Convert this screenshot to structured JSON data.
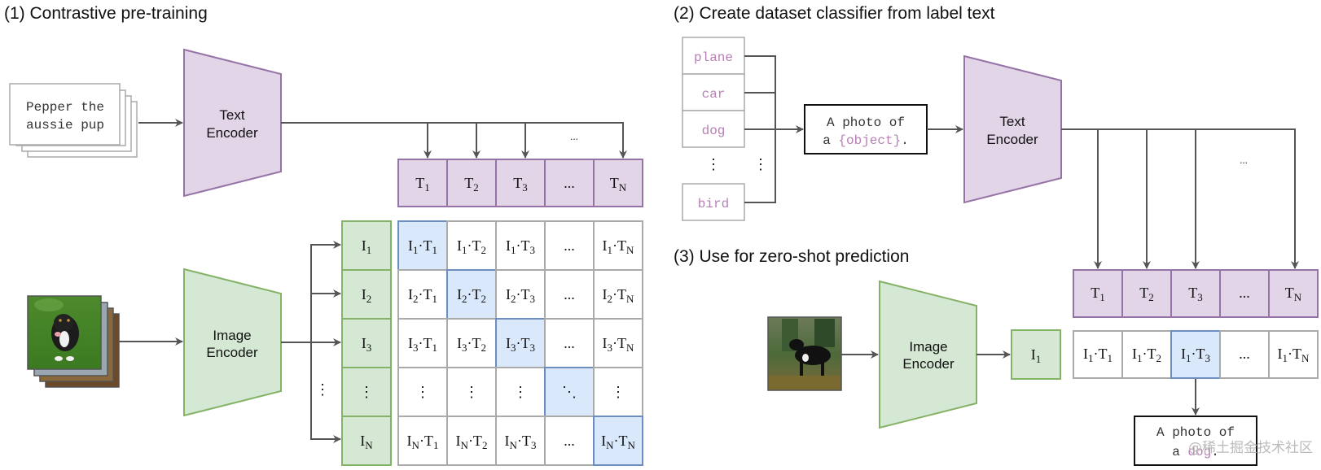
{
  "section1": {
    "title": "(1) Contrastive pre-training",
    "text_input": [
      "Pepper the",
      "aussie pup"
    ],
    "text_encoder": [
      "Text",
      "Encoder"
    ],
    "image_encoder": [
      "Image",
      "Encoder"
    ],
    "text_embeddings": [
      {
        "base": "T",
        "sub": "1"
      },
      {
        "base": "T",
        "sub": "2"
      },
      {
        "base": "T",
        "sub": "3"
      },
      {
        "base": "...",
        "sub": ""
      },
      {
        "base": "T",
        "sub": "N"
      }
    ],
    "image_embeddings": [
      {
        "base": "I",
        "sub": "1"
      },
      {
        "base": "I",
        "sub": "2"
      },
      {
        "base": "I",
        "sub": "3"
      },
      {
        "base": "⋮",
        "sub": ""
      },
      {
        "base": "I",
        "sub": "N"
      }
    ],
    "arrow_ellipsis": "...",
    "vertical_ellipsis": "⋮",
    "matrix_rows": [
      "1",
      "2",
      "3",
      "",
      "N"
    ],
    "matrix_cols": [
      "1",
      "2",
      "3",
      "",
      "N"
    ],
    "ellipsis_h": "...",
    "ellipsis_v": "⋮",
    "ellipsis_diag": "⋱"
  },
  "section2": {
    "title": "(2) Create dataset classifier from label text",
    "labels": [
      "plane",
      "car",
      "dog",
      "bird"
    ],
    "label_ellipsis": "⋮",
    "template_line1": "A photo of",
    "template_line2_prefix": "a ",
    "template_placeholder": "{object}",
    "template_line2_suffix": ".",
    "text_encoder": [
      "Text",
      "Encoder"
    ],
    "arrow_ellipsis": "..."
  },
  "section3": {
    "title": "(3) Use for zero-shot prediction",
    "image_encoder": [
      "Image",
      "Encoder"
    ],
    "image_embedding": {
      "base": "I",
      "sub": "1"
    },
    "text_embeddings": [
      {
        "base": "T",
        "sub": "1"
      },
      {
        "base": "T",
        "sub": "2"
      },
      {
        "base": "T",
        "sub": "3"
      },
      {
        "base": "...",
        "sub": ""
      },
      {
        "base": "T",
        "sub": "N"
      }
    ],
    "scores": [
      "1",
      "2",
      "3",
      "",
      "N"
    ],
    "highlight_index": 2,
    "result_line1": "A photo of",
    "result_line2_prefix": "a ",
    "result_word": "dog",
    "result_line2_suffix": "."
  },
  "watermark": "@稀土掘金技术社区",
  "colors": {
    "text_purple": "#e1d5e7",
    "image_green": "#d5e8d4",
    "highlight_blue": "#dae8fc",
    "label_pink": "#b77fb5"
  }
}
